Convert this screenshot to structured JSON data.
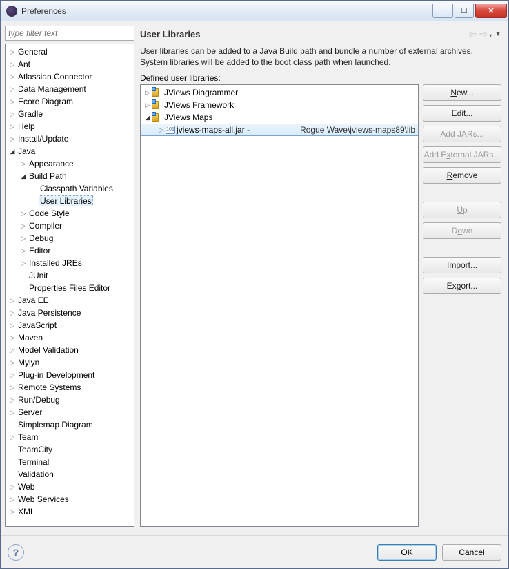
{
  "window": {
    "title": "Preferences"
  },
  "filter": {
    "placeholder": "type filter text"
  },
  "tree": {
    "items": [
      {
        "label": "General",
        "depth": 1,
        "expandable": true,
        "open": false
      },
      {
        "label": "Ant",
        "depth": 1,
        "expandable": true,
        "open": false
      },
      {
        "label": "Atlassian Connector",
        "depth": 1,
        "expandable": true,
        "open": false
      },
      {
        "label": "Data Management",
        "depth": 1,
        "expandable": true,
        "open": false
      },
      {
        "label": "Ecore Diagram",
        "depth": 1,
        "expandable": true,
        "open": false
      },
      {
        "label": "Gradle",
        "depth": 1,
        "expandable": true,
        "open": false
      },
      {
        "label": "Help",
        "depth": 1,
        "expandable": true,
        "open": false
      },
      {
        "label": "Install/Update",
        "depth": 1,
        "expandable": true,
        "open": false
      },
      {
        "label": "Java",
        "depth": 1,
        "expandable": true,
        "open": true
      },
      {
        "label": "Appearance",
        "depth": 2,
        "expandable": true,
        "open": false
      },
      {
        "label": "Build Path",
        "depth": 2,
        "expandable": true,
        "open": true
      },
      {
        "label": "Classpath Variables",
        "depth": 3,
        "expandable": false,
        "open": false
      },
      {
        "label": "User Libraries",
        "depth": 3,
        "expandable": false,
        "open": false,
        "selected": true
      },
      {
        "label": "Code Style",
        "depth": 2,
        "expandable": true,
        "open": false
      },
      {
        "label": "Compiler",
        "depth": 2,
        "expandable": true,
        "open": false
      },
      {
        "label": "Debug",
        "depth": 2,
        "expandable": true,
        "open": false
      },
      {
        "label": "Editor",
        "depth": 2,
        "expandable": true,
        "open": false
      },
      {
        "label": "Installed JREs",
        "depth": 2,
        "expandable": true,
        "open": false
      },
      {
        "label": "JUnit",
        "depth": 2,
        "expandable": false,
        "open": false
      },
      {
        "label": "Properties Files Editor",
        "depth": 2,
        "expandable": false,
        "open": false
      },
      {
        "label": "Java EE",
        "depth": 1,
        "expandable": true,
        "open": false
      },
      {
        "label": "Java Persistence",
        "depth": 1,
        "expandable": true,
        "open": false
      },
      {
        "label": "JavaScript",
        "depth": 1,
        "expandable": true,
        "open": false
      },
      {
        "label": "Maven",
        "depth": 1,
        "expandable": true,
        "open": false
      },
      {
        "label": "Model Validation",
        "depth": 1,
        "expandable": true,
        "open": false
      },
      {
        "label": "Mylyn",
        "depth": 1,
        "expandable": true,
        "open": false
      },
      {
        "label": "Plug-in Development",
        "depth": 1,
        "expandable": true,
        "open": false
      },
      {
        "label": "Remote Systems",
        "depth": 1,
        "expandable": true,
        "open": false
      },
      {
        "label": "Run/Debug",
        "depth": 1,
        "expandable": true,
        "open": false
      },
      {
        "label": "Server",
        "depth": 1,
        "expandable": true,
        "open": false
      },
      {
        "label": "Simplemap Diagram",
        "depth": 1,
        "expandable": false,
        "open": false
      },
      {
        "label": "Team",
        "depth": 1,
        "expandable": true,
        "open": false
      },
      {
        "label": "TeamCity",
        "depth": 1,
        "expandable": false,
        "open": false
      },
      {
        "label": "Terminal",
        "depth": 1,
        "expandable": false,
        "open": false
      },
      {
        "label": "Validation",
        "depth": 1,
        "expandable": false,
        "open": false
      },
      {
        "label": "Web",
        "depth": 1,
        "expandable": true,
        "open": false
      },
      {
        "label": "Web Services",
        "depth": 1,
        "expandable": true,
        "open": false
      },
      {
        "label": "XML",
        "depth": 1,
        "expandable": true,
        "open": false
      }
    ]
  },
  "page": {
    "title": "User Libraries",
    "description": "User libraries can be added to a Java Build path and bundle a number of external archives. System libraries will be added to the boot class path when launched.",
    "defined_label_pre": "D",
    "defined_label_post": "efined user libraries:"
  },
  "libs": {
    "items": [
      {
        "label": "JViews Diagrammer",
        "depth": 1,
        "icon": "lib",
        "expandable": true,
        "open": false
      },
      {
        "label": "JViews Framework",
        "depth": 1,
        "icon": "lib",
        "expandable": true,
        "open": false
      },
      {
        "label": "JViews Maps",
        "depth": 1,
        "icon": "lib",
        "expandable": true,
        "open": true
      },
      {
        "label": "jviews-maps-all.jar - ",
        "path": "Rogue Wave\\jviews-maps89\\lib",
        "depth": 2,
        "icon": "jar",
        "expandable": true,
        "open": false,
        "selected": true
      }
    ]
  },
  "buttons": {
    "new": "New...",
    "edit": "Edit...",
    "addjars": "Add JARs...",
    "addext_pre": "Add E",
    "addext_u": "x",
    "addext_post": "ternal JARs...",
    "remove": "Remove",
    "up": "Up",
    "down": "Down",
    "import": "Import...",
    "export": "Export..."
  },
  "footer": {
    "ok": "OK",
    "cancel": "Cancel"
  }
}
